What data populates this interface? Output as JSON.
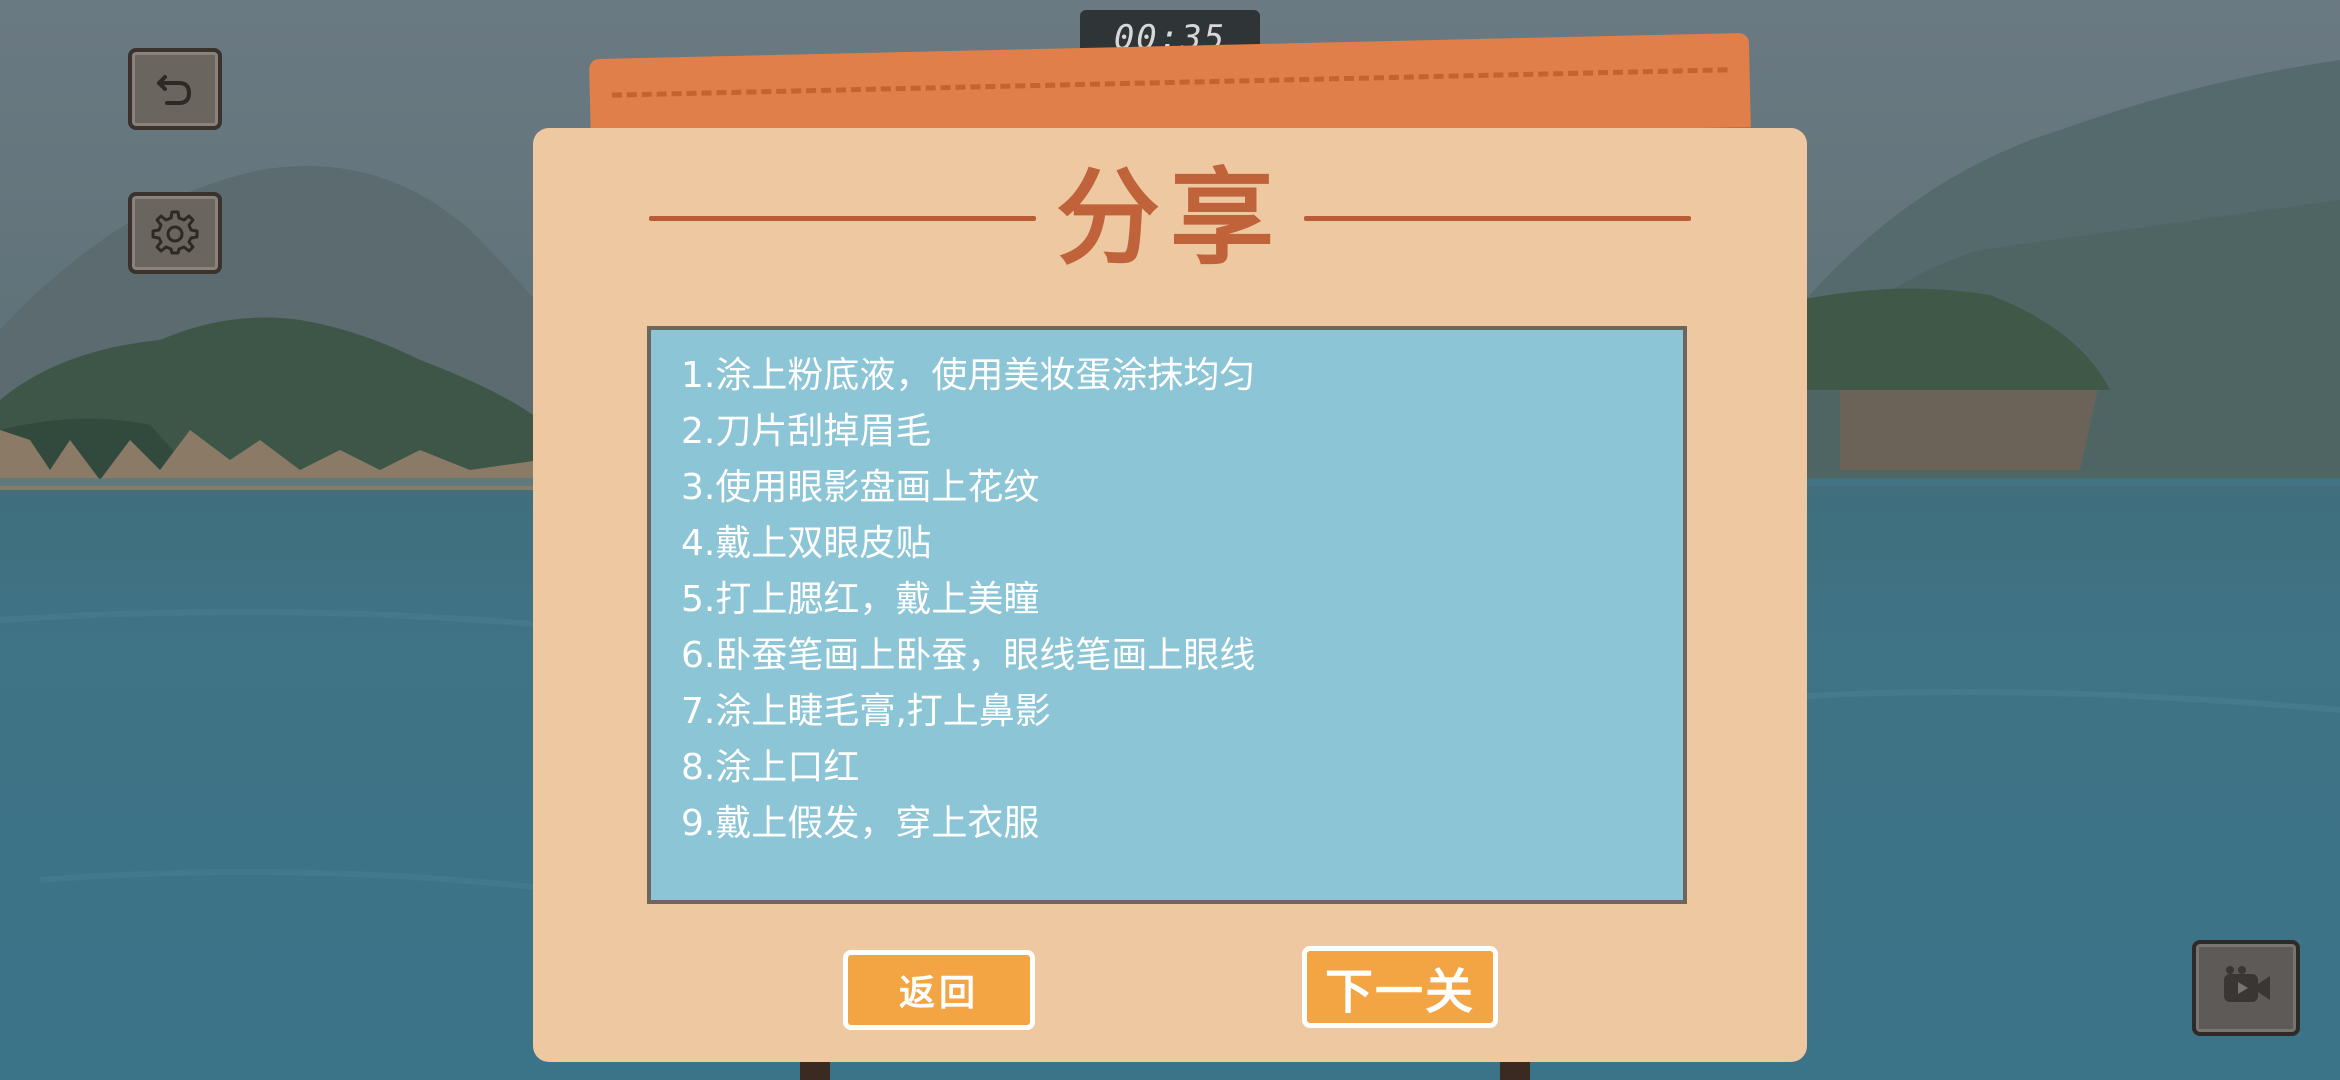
{
  "timer": "00:35",
  "dialog": {
    "title": "分享",
    "steps": [
      "1.涂上粉底液，使用美妆蛋涂抹均匀",
      "2.刀片刮掉眉毛",
      "3.使用眼影盘画上花纹",
      "4.戴上双眼皮贴",
      "5.打上腮红，戴上美瞳",
      "6.卧蚕笔画上卧蚕，眼线笔画上眼线",
      "7.涂上睫毛膏,打上鼻影",
      "8.涂上口红",
      "9.戴上假发，穿上衣服"
    ],
    "back_label": "返回",
    "next_label": "下一关"
  },
  "icons": {
    "undo": "undo-icon",
    "settings": "gear-icon",
    "video": "video-icon"
  },
  "colors": {
    "panel": "#edc8a1",
    "title": "#c0623a",
    "steps_bg": "#8bc5d6",
    "button": "#f3a443",
    "tab": "#e07f49"
  }
}
